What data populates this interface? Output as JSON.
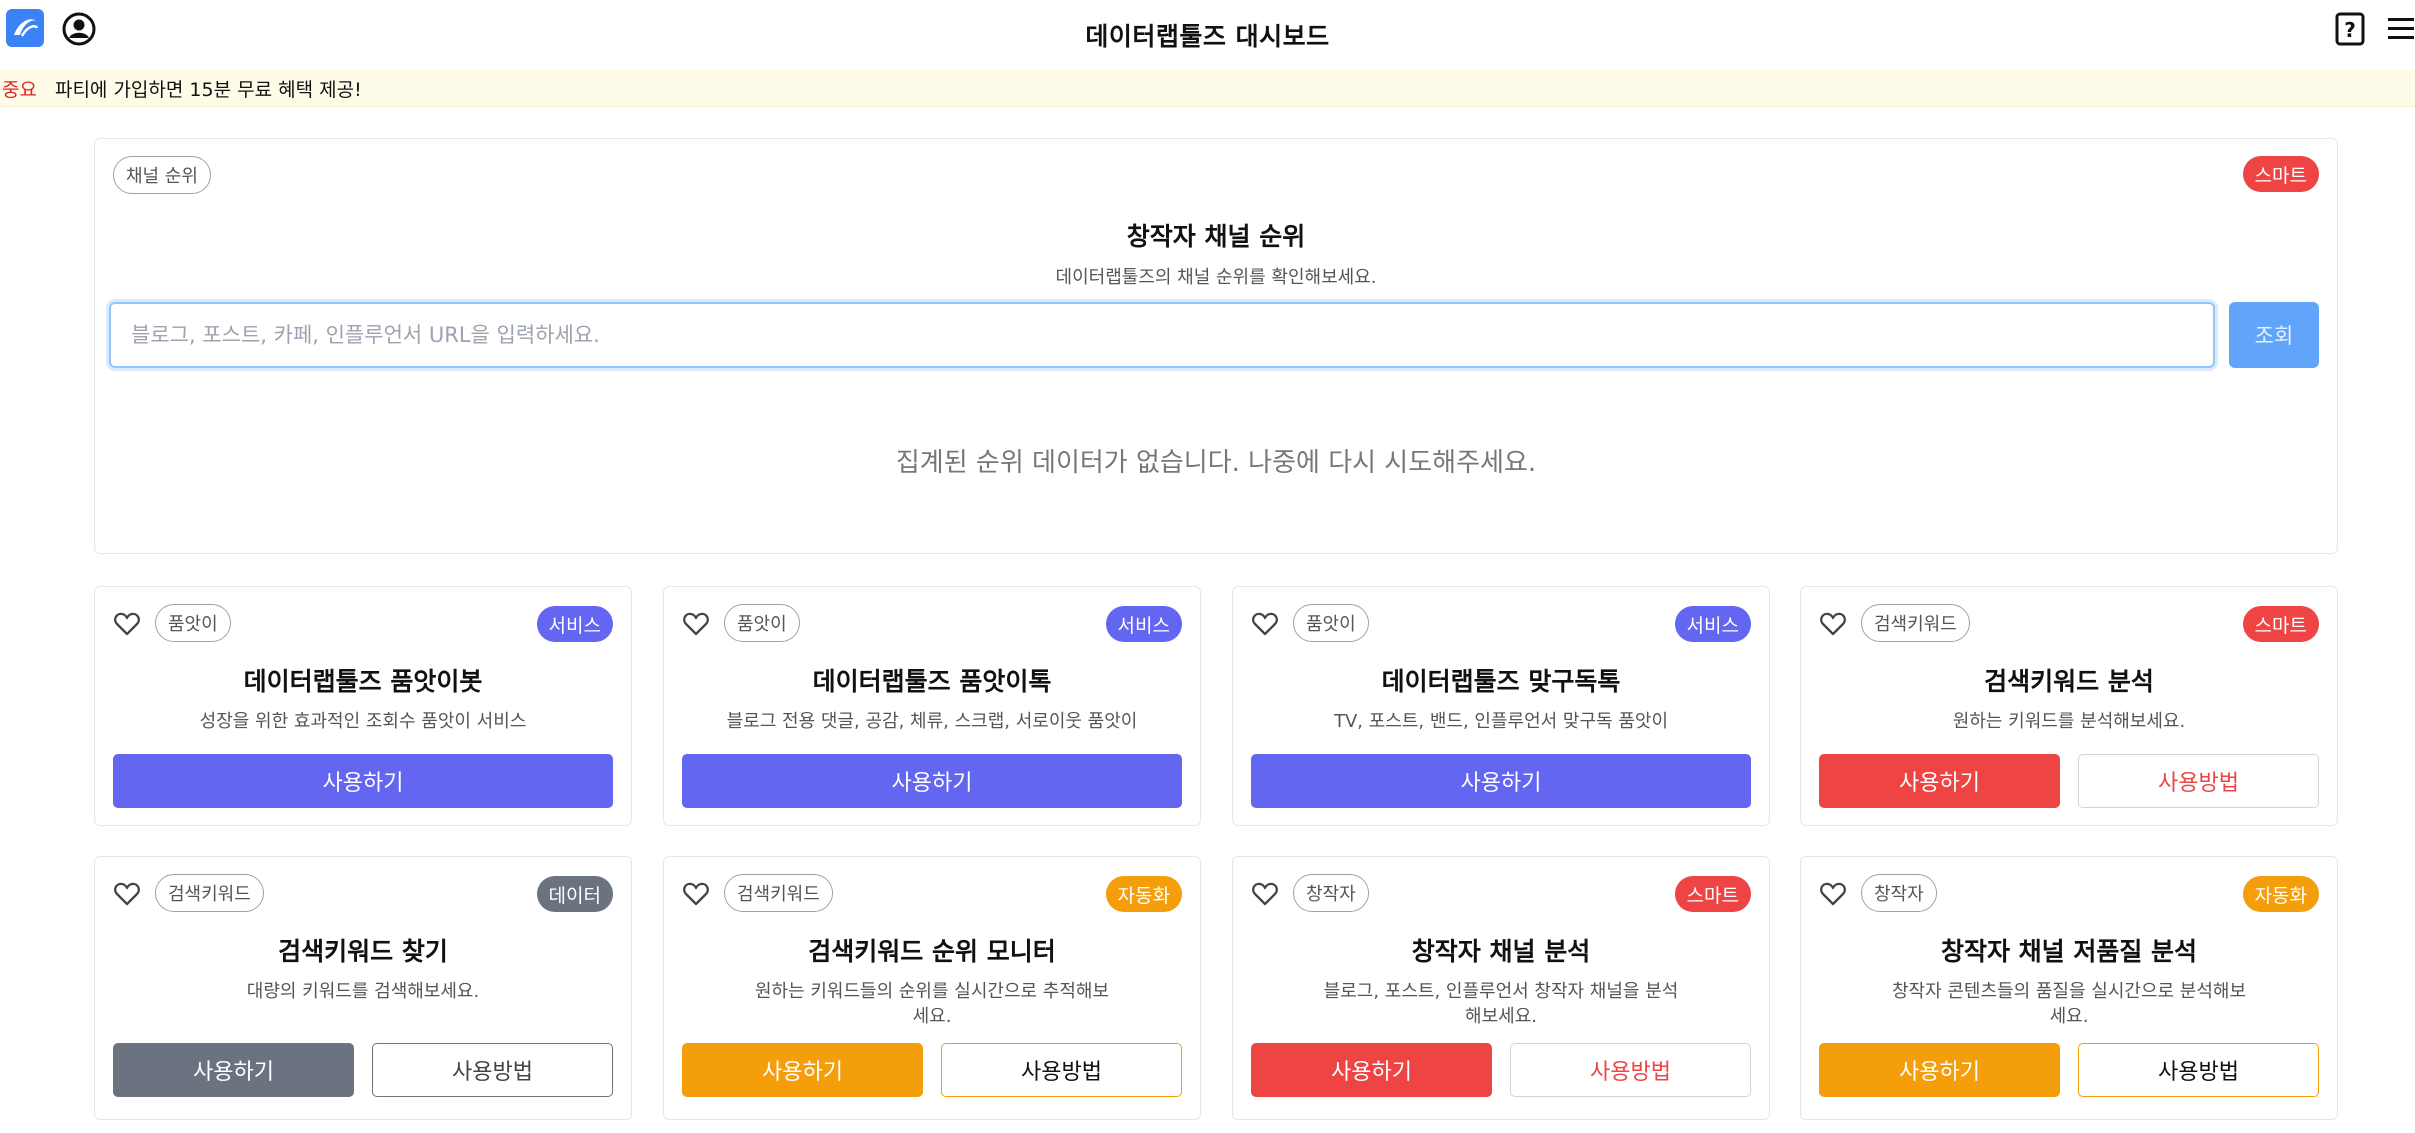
{
  "header": {
    "title": "데이터랩툴즈 대시보드",
    "logo_icon": "logo-icon",
    "user_icon": "user-circle-icon",
    "help_icon": "help-icon",
    "menu_icon": "hamburger-menu-icon"
  },
  "notice": {
    "tag": "중요",
    "message": "파티에 가입하면 15분 무료 혜택 제공!"
  },
  "hero": {
    "category": "채널 순위",
    "badge": "스마트",
    "title": "창작자 채널 순위",
    "subtitle": "데이터랩툴즈의 채널 순위를 확인해보세요.",
    "search_placeholder": "블로그, 포스트, 카페, 인플루언서 URL을 입력하세요.",
    "search_button": "조회",
    "empty_message": "집계된 순위 데이터가 없습니다. 나중에 다시 시도해주세요."
  },
  "colors": {
    "service": "#6366f1",
    "smart": "#ef4444",
    "data": "#6b7280",
    "automation": "#f59e0b"
  },
  "tools": [
    {
      "category": "품앗이",
      "badge": "서비스",
      "title": "데이터랩툴즈 품앗이봇",
      "desc": "성장을 위한 효과적인 조회수 품앗이 서비스",
      "use": "사용하기"
    },
    {
      "category": "품앗이",
      "badge": "서비스",
      "title": "데이터랩툴즈 품앗이톡",
      "desc": "블로그 전용 댓글, 공감, 체류, 스크랩, 서로이웃 품앗이",
      "use": "사용하기"
    },
    {
      "category": "품앗이",
      "badge": "서비스",
      "title": "데이터랩툴즈 맞구독톡",
      "desc": "TV, 포스트, 밴드, 인플루언서 맞구독 품앗이",
      "use": "사용하기"
    },
    {
      "category": "검색키워드",
      "badge": "스마트",
      "title": "검색키워드 분석",
      "desc": "원하는 키워드를 분석해보세요.",
      "use": "사용하기",
      "howto": "사용방법"
    },
    {
      "category": "검색키워드",
      "badge": "데이터",
      "title": "검색키워드 찾기",
      "desc": "대량의 키워드를 검색해보세요.",
      "use": "사용하기",
      "howto": "사용방법"
    },
    {
      "category": "검색키워드",
      "badge": "자동화",
      "title": "검색키워드 순위 모니터",
      "desc": "원하는 키워드들의 순위를 실시간으로 추적해보세요.",
      "use": "사용하기",
      "howto": "사용방법"
    },
    {
      "category": "창작자",
      "badge": "스마트",
      "title": "창작자 채널 분석",
      "desc": "블로그, 포스트, 인플루언서 창작자 채널을 분석해보세요.",
      "use": "사용하기",
      "howto": "사용방법"
    },
    {
      "category": "창작자",
      "badge": "자동화",
      "title": "창작자 채널 저품질 분석",
      "desc": "창작자 콘텐츠들의 품질을 실시간으로 분석해보세요.",
      "use": "사용하기",
      "howto": "사용방법"
    }
  ]
}
